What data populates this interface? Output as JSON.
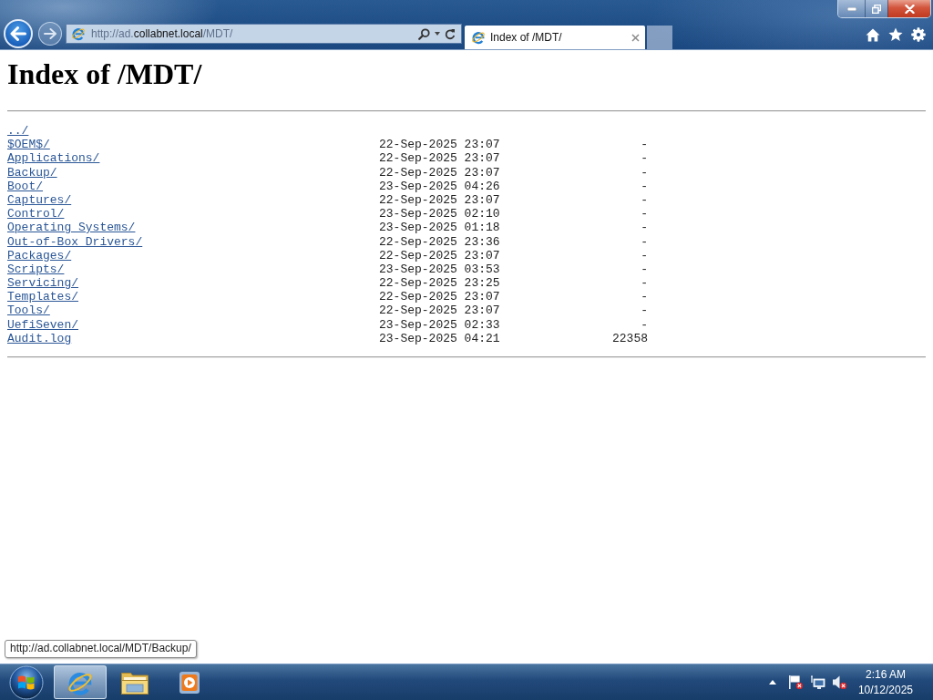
{
  "browser": {
    "address": {
      "prefix": "http://ad.",
      "domain": "collabnet.local",
      "path": "/MDT/"
    },
    "tabs": [
      {
        "title": "Index of /MDT/",
        "selected": true
      }
    ],
    "status_tooltip": "http://ad.collabnet.local/MDT/Backup/"
  },
  "page": {
    "heading": "Index of /MDT/",
    "entries": [
      {
        "name": "../"
      },
      {
        "name": "$OEM$/",
        "modified": "22-Sep-2025 23:07",
        "size": "-"
      },
      {
        "name": "Applications/",
        "modified": "22-Sep-2025 23:07",
        "size": "-"
      },
      {
        "name": "Backup/",
        "modified": "22-Sep-2025 23:07",
        "size": "-"
      },
      {
        "name": "Boot/",
        "modified": "23-Sep-2025 04:26",
        "size": "-"
      },
      {
        "name": "Captures/",
        "modified": "22-Sep-2025 23:07",
        "size": "-"
      },
      {
        "name": "Control/",
        "modified": "23-Sep-2025 02:10",
        "size": "-"
      },
      {
        "name": "Operating Systems/",
        "modified": "23-Sep-2025 01:18",
        "size": "-"
      },
      {
        "name": "Out-of-Box Drivers/",
        "modified": "22-Sep-2025 23:36",
        "size": "-"
      },
      {
        "name": "Packages/",
        "modified": "22-Sep-2025 23:07",
        "size": "-"
      },
      {
        "name": "Scripts/",
        "modified": "23-Sep-2025 03:53",
        "size": "-"
      },
      {
        "name": "Servicing/",
        "modified": "22-Sep-2025 23:25",
        "size": "-"
      },
      {
        "name": "Templates/",
        "modified": "22-Sep-2025 23:07",
        "size": "-"
      },
      {
        "name": "Tools/",
        "modified": "22-Sep-2025 23:07",
        "size": "-"
      },
      {
        "name": "UefiSeven/",
        "modified": "23-Sep-2025 02:33",
        "size": "-"
      },
      {
        "name": "Audit.log",
        "modified": "23-Sep-2025 04:21",
        "size": "22358"
      }
    ]
  },
  "taskbar": {
    "apps": [
      {
        "kind": "browser",
        "selected": true
      },
      {
        "kind": "folder",
        "selected": false
      },
      {
        "kind": "media",
        "selected": false
      }
    ],
    "tray": {
      "action_center_alert": true,
      "volume_muted": true
    },
    "clock": {
      "time": "2:16 AM",
      "date": "10/12/2025"
    }
  }
}
